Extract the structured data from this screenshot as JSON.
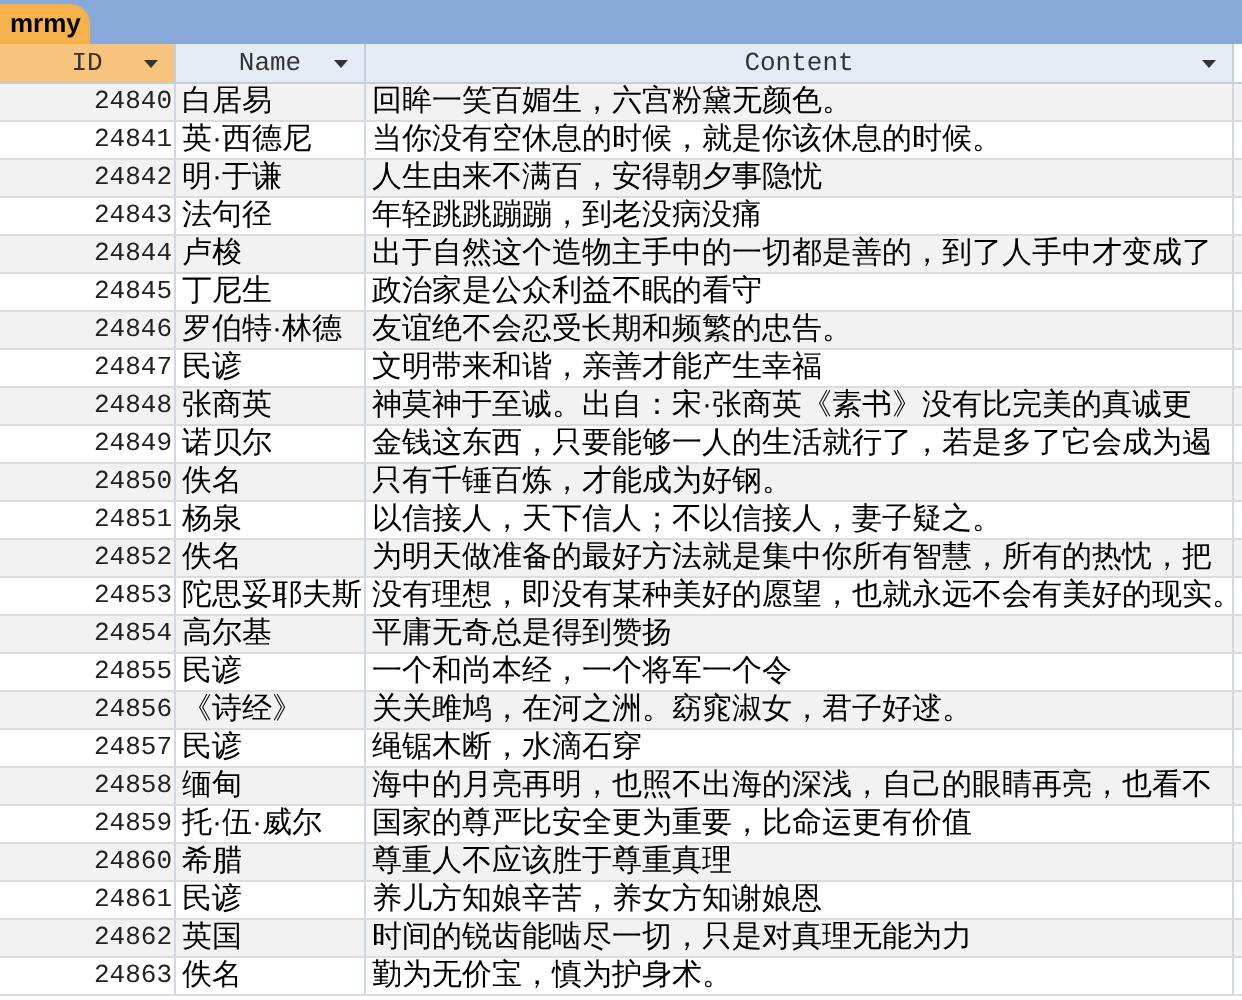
{
  "tab": {
    "label": "mrmy",
    "selected": true
  },
  "table": {
    "columns": [
      {
        "label": "ID",
        "selected": true
      },
      {
        "label": "Name",
        "selected": false
      },
      {
        "label": "Content",
        "selected": false
      }
    ],
    "rows": [
      [
        "24840",
        "白居易",
        "回眸一笑百媚生，六宫粉黛无颜色。"
      ],
      [
        "24841",
        "英·西德尼",
        "当你没有空休息的时候，就是你该休息的时候。"
      ],
      [
        "24842",
        "明·于谦",
        "人生由来不满百，安得朝夕事隐忧"
      ],
      [
        "24843",
        "法句径",
        "年轻跳跳蹦蹦，到老没病没痛"
      ],
      [
        "24844",
        "卢梭",
        "出于自然这个造物主手中的一切都是善的，到了人手中才变成了"
      ],
      [
        "24845",
        "丁尼生",
        "政治家是公众利益不眠的看守"
      ],
      [
        "24846",
        "罗伯特·林德",
        "友谊绝不会忍受长期和频繁的忠告。"
      ],
      [
        "24847",
        "民谚",
        "文明带来和谐，亲善才能产生幸福"
      ],
      [
        "24848",
        "张商英",
        "神莫神于至诚。出自：宋·张商英《素书》没有比完美的真诚更"
      ],
      [
        "24849",
        "诺贝尔",
        "金钱这东西，只要能够一人的生活就行了，若是多了它会成为遏"
      ],
      [
        "24850",
        "佚名",
        "只有千锤百炼，才能成为好钢。"
      ],
      [
        "24851",
        "杨泉",
        "以信接人，天下信人；不以信接人，妻子疑之。"
      ],
      [
        "24852",
        "佚名",
        "为明天做准备的最好方法就是集中你所有智慧，所有的热忱，把"
      ],
      [
        "24853",
        "陀思妥耶夫斯",
        "没有理想，即没有某种美好的愿望，也就永远不会有美好的现实。"
      ],
      [
        "24854",
        "高尔基",
        "平庸无奇总是得到赞扬"
      ],
      [
        "24855",
        "民谚",
        "一个和尚本经，一个将军一个令"
      ],
      [
        "24856",
        "《诗经》",
        "关关雎鸠，在河之洲。窈窕淑女，君子好逑。"
      ],
      [
        "24857",
        "民谚",
        "绳锯木断，水滴石穿"
      ],
      [
        "24858",
        "缅甸",
        "海中的月亮再明，也照不出海的深浅，自己的眼睛再亮，也看不"
      ],
      [
        "24859",
        "托·伍·威尔",
        "国家的尊严比安全更为重要，比命运更有价值"
      ],
      [
        "24860",
        "希腊",
        "尊重人不应该胜于尊重真理"
      ],
      [
        "24861",
        "民谚",
        "养儿方知娘辛苦，养女方知谢娘恩"
      ],
      [
        "24862",
        "英国",
        "时间的锐齿能啮尽一切，只是对真理无能为力"
      ],
      [
        "24863",
        "佚名",
        "勤为无价宝，慎为护身术。"
      ]
    ]
  }
}
